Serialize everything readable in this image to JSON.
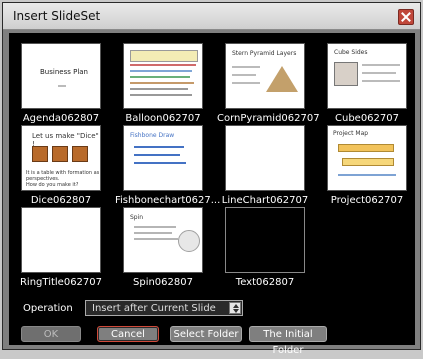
{
  "window": {
    "title": "Insert SlideSet"
  },
  "slides": [
    {
      "name": "Agenda062807"
    },
    {
      "name": "Balloon062707"
    },
    {
      "name": "CornPyramid062707"
    },
    {
      "name": "Cube062707"
    },
    {
      "name": "Dice062807"
    },
    {
      "name": "Fishbonechart0627..."
    },
    {
      "name": "LineChart062707"
    },
    {
      "name": "Project062707"
    },
    {
      "name": "RingTitle062707"
    },
    {
      "name": "Spin062807"
    },
    {
      "name": "Text062807"
    }
  ],
  "thumb_text": {
    "agenda_title": "Business Plan",
    "dice_title": "Let us make \"Dice\" !",
    "dice_caption": "It is a table with formation as perspectives.\nHow do you make it?",
    "fishbone_title": "Fishbone Draw",
    "corn_title": "Stern Pyramid Layers",
    "cube_label": "Cube Sides",
    "project_title": "Project Map",
    "spin_title": "Spin"
  },
  "operation": {
    "label": "Operation",
    "value": "Insert after Current Slide"
  },
  "buttons": {
    "ok": "OK",
    "cancel": "Cancel",
    "select_folder": "Select Folder",
    "initial_folder": "The Initial Folder"
  }
}
